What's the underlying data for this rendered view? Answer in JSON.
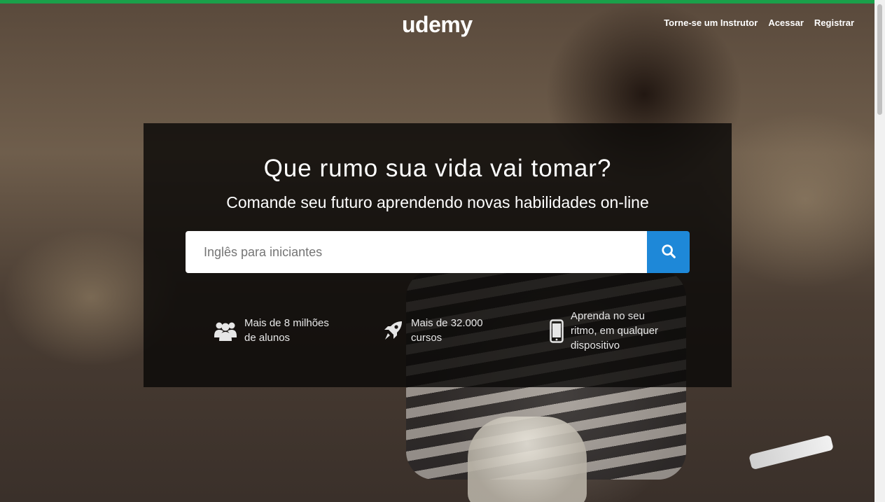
{
  "header": {
    "logo": "udemy",
    "nav": [
      {
        "label": "Torne-se um Instrutor"
      },
      {
        "label": "Acessar"
      },
      {
        "label": "Registrar"
      }
    ]
  },
  "hero": {
    "title": "Que rumo sua vida vai tomar?",
    "subtitle": "Comande seu futuro aprendendo novas habilidades on-line",
    "search": {
      "placeholder": "Inglês para iniciantes",
      "button_icon": "search-icon"
    },
    "features": [
      {
        "icon": "users-icon",
        "line1": "Mais de 8 milhões",
        "line2": "de alunos"
      },
      {
        "icon": "rocket-icon",
        "line1": "Mais de 32.000",
        "line2": "cursos"
      },
      {
        "icon": "smartphone-icon",
        "line1": "Aprenda no seu",
        "line2": "ritmo, em qualquer",
        "line3": "dispositivo"
      }
    ]
  },
  "colors": {
    "accent_top_bar": "#1aa04a",
    "search_button": "#1e88d8"
  }
}
